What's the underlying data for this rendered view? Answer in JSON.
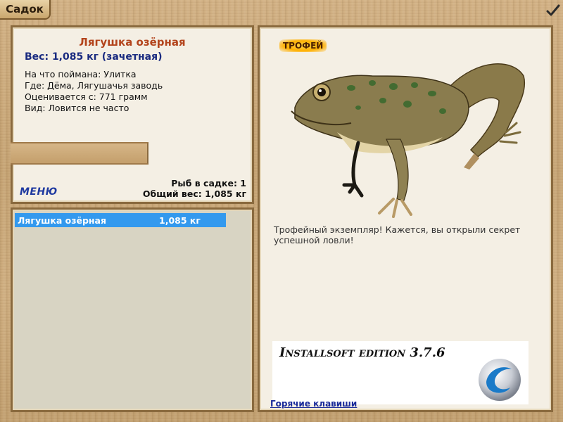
{
  "window": {
    "title": "Садок"
  },
  "icons": {
    "confirm": "checkmark-icon"
  },
  "info": {
    "fish_name": "Лягушка озёрная",
    "weight_line": "Вес: 1,085 кг (зачетная)",
    "caught_on": "На что поймана: Улитка",
    "location": "Где: Дёма, Лягушачья заводь",
    "valued_from": "Оценивается с: 771 грамм",
    "rarity": "Вид: Ловится не часто",
    "menu_label": "МЕНЮ",
    "fish_count": "Рыб в садке: 1",
    "total_weight": "Общий вес: 1,085 кг"
  },
  "list": {
    "items": [
      {
        "name": "Лягушка озёрная",
        "weight": "1,085 кг",
        "selected": true
      }
    ]
  },
  "detail": {
    "badge": "ТРОФЕЙ",
    "description": "Трофейный экземпляр! Кажется, вы открыли секрет успешной ловли!",
    "edition": "Installsoft edition 3.7.6",
    "hotkeys": "Горячие клавиши"
  },
  "colors": {
    "fish_name": "#b3441c",
    "weight": "#1a2b80",
    "selection": "#3399ee",
    "link": "#1a2b9a"
  }
}
